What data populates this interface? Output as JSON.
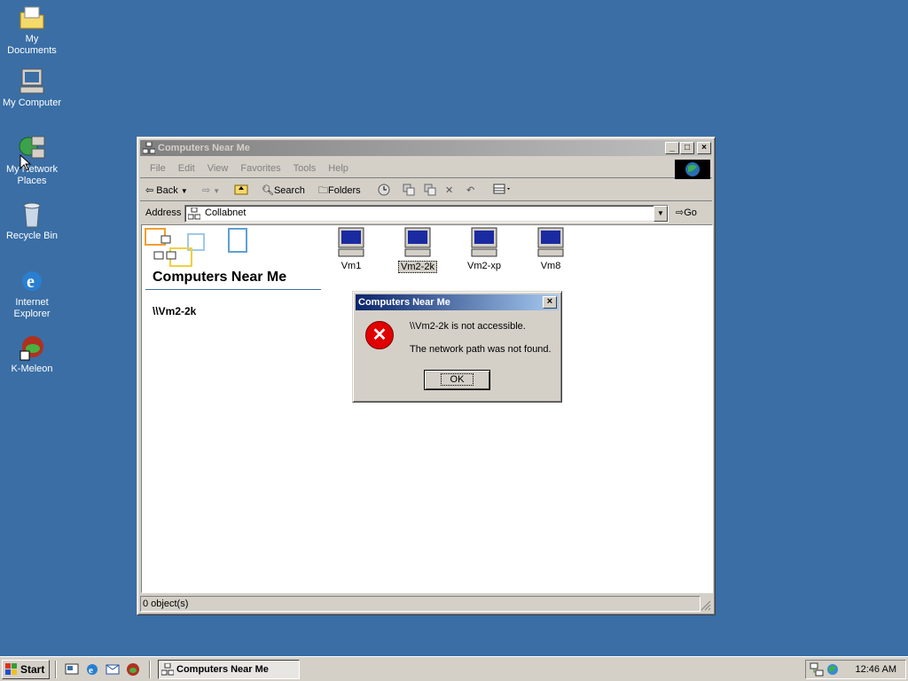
{
  "desktop": {
    "icons": [
      {
        "label_1": "My Documents",
        "label_2": ""
      },
      {
        "label_1": "My Computer",
        "label_2": ""
      },
      {
        "label_1": "My Network",
        "label_2": "Places"
      },
      {
        "label_1": "Recycle Bin",
        "label_2": ""
      },
      {
        "label_1": "Internet",
        "label_2": "Explorer"
      },
      {
        "label_1": "K-Meleon",
        "label_2": ""
      }
    ]
  },
  "window": {
    "title": "Computers Near Me",
    "menu": [
      "File",
      "Edit",
      "View",
      "Favorites",
      "Tools",
      "Help"
    ],
    "toolbar": {
      "back": "Back",
      "search": "Search",
      "folders": "Folders"
    },
    "address": {
      "label": "Address",
      "value": "Collabnet",
      "go": "Go"
    },
    "folder_title": "Computers Near Me",
    "selected_path": "\\\\Vm2-2k",
    "computers": [
      "Vm1",
      "Vm2-2k",
      "Vm2-xp",
      "Vm8"
    ],
    "status": "0 object(s)"
  },
  "dialog": {
    "title": "Computers Near Me",
    "line1": "\\\\Vm2-2k is not accessible.",
    "line2": "The network path was not found.",
    "ok": "OK"
  },
  "taskbar": {
    "start": "Start",
    "task": "Computers Near Me",
    "clock": "12:46 AM"
  },
  "colors": {
    "desktop": "#3a6ea5",
    "active_title": "#0a246a",
    "inactive_title": "#808080",
    "face": "#d4d0c8"
  }
}
